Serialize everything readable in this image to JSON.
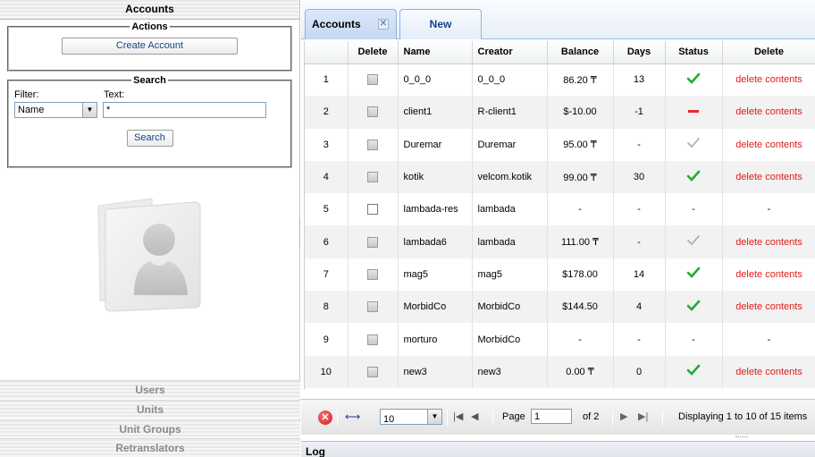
{
  "left": {
    "title": "Accounts",
    "actions": {
      "legend": "Actions",
      "create_label": "Create Account"
    },
    "search": {
      "legend": "Search",
      "filter_label": "Filter:",
      "text_label": "Text:",
      "filter_value": "Name",
      "text_value": "*",
      "search_label": "Search"
    },
    "nav": [
      "Users",
      "Units",
      "Unit Groups",
      "Retranslators"
    ]
  },
  "tabs": {
    "accounts_label": "Accounts",
    "new_label": "New"
  },
  "grid": {
    "columns": [
      "",
      "Delete",
      "Name",
      "Creator",
      "Balance",
      "Days",
      "Status",
      "Delete"
    ],
    "rows": [
      {
        "num": "1",
        "checkbox": "gray",
        "name": "0_0_0",
        "creator": "0_0_0",
        "balance": "86.20 ₸",
        "days": "13",
        "status": "ok",
        "delete": "delete contents"
      },
      {
        "num": "2",
        "checkbox": "gray",
        "name": "client1",
        "creator": "R-client1",
        "balance": "$-10.00",
        "days": "-1",
        "status": "minus",
        "delete": "delete contents"
      },
      {
        "num": "3",
        "checkbox": "gray",
        "name": "Duremar",
        "creator": "Duremar",
        "balance": "95.00 ₸",
        "days": "-",
        "status": "gray-check",
        "delete": "delete contents"
      },
      {
        "num": "4",
        "checkbox": "gray",
        "name": "kotik",
        "creator": "velcom.kotik",
        "balance": "99.00 ₸",
        "days": "30",
        "status": "ok",
        "delete": "delete contents"
      },
      {
        "num": "5",
        "checkbox": "white",
        "name": "lambada-res",
        "creator": "lambada",
        "balance": "-",
        "days": "-",
        "status": "none",
        "status_text": "-",
        "delete": "-"
      },
      {
        "num": "6",
        "checkbox": "gray",
        "name": "lambada6",
        "creator": "lambada",
        "balance": "111.00 ₸",
        "days": "-",
        "status": "gray-check",
        "delete": "delete contents"
      },
      {
        "num": "7",
        "checkbox": "gray",
        "name": "mag5",
        "creator": "mag5",
        "balance": "$178.00",
        "days": "14",
        "status": "ok",
        "delete": "delete contents"
      },
      {
        "num": "8",
        "checkbox": "gray",
        "name": "MorbidCo",
        "creator": "MorbidCo",
        "balance": "$144.50",
        "days": "4",
        "status": "ok",
        "delete": "delete contents"
      },
      {
        "num": "9",
        "checkbox": "gray",
        "name": "morturo",
        "creator": "MorbidCo",
        "balance": "-",
        "days": "-",
        "status": "none",
        "status_text": "-",
        "delete": "-"
      },
      {
        "num": "10",
        "checkbox": "gray",
        "name": "new3",
        "creator": "new3",
        "balance": "0.00 ₸",
        "days": "0",
        "status": "ok",
        "delete": "delete contents"
      }
    ]
  },
  "pager": {
    "page_size": "10",
    "page_label": "Page",
    "page_value": "1",
    "of_label": "of 2",
    "display_text": "Displaying 1 to 10 of 15 items"
  },
  "log": {
    "title": "Log"
  },
  "colors": {
    "ok_green": "#1fae2e",
    "minus_red": "#e32a2a",
    "neutral_gray": "#a8a8a8",
    "link_red": "#e01b1b",
    "tab_text": "#15428b"
  },
  "icons": {
    "cancel": "cancel-icon",
    "page_size": "resize-arrows-icon",
    "first": "first-page-icon",
    "prev": "prev-page-icon",
    "next": "next-page-icon",
    "last": "last-page-icon"
  }
}
